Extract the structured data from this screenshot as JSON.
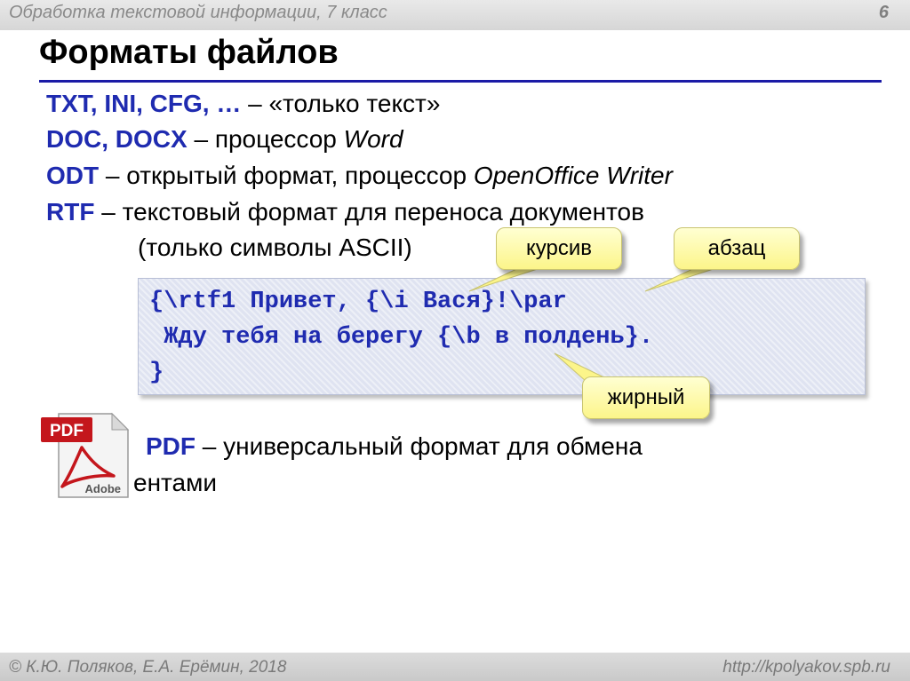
{
  "header": {
    "course": "Обработка текстовой информации, 7 класс",
    "page_number": "6"
  },
  "title": "Форматы файлов",
  "lines": [
    {
      "kw": "TXT, INI, CFG, …",
      "rest": "  – «только текст»"
    },
    {
      "kw": "DOC, DOCX",
      "rest": " – процессор ",
      "italic": "Word"
    },
    {
      "kw": "ODT",
      "rest": " – открытый формат, процессор ",
      "italic": "OpenOffice Writer"
    },
    {
      "kw": "RTF",
      "rest": " – текстовый формат для переноса документов"
    },
    {
      "rest": "(только символы ASCII)"
    }
  ],
  "code": [
    "{\\rtf1 Привет, {\\i Вася}!\\par",
    " Жду тебя на берегу {\\b в полдень}.",
    "}"
  ],
  "callouts": {
    "italic": "курсив",
    "paragraph": "абзац",
    "bold": "жирный"
  },
  "pdf": {
    "kw": "PDF",
    "rest": " – универсальный формат для обмена",
    "rest2": "ентами",
    "icon_label": "PDF",
    "icon_brand": "Adobe"
  },
  "footer": {
    "authors": "© К.Ю. Поляков, Е.А. Ерёмин, 2018",
    "url": "http://kpolyakov.spb.ru"
  },
  "colors": {
    "keyword": "#1f2bb0",
    "title_rule": "#1a1aa6",
    "callout": "#fcf58a",
    "pdf_red": "#c4161c"
  }
}
